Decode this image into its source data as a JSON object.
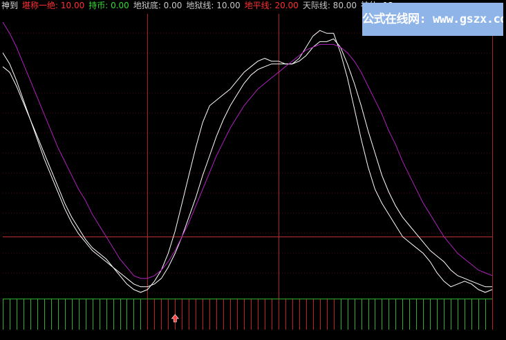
{
  "header": [
    {
      "label": "神到",
      "color": "#dcdcdc"
    },
    {
      "label": "堪称一绝: 10.00",
      "color": "#ff3030"
    },
    {
      "label": "持币: 0.00",
      "color": "#33dd33"
    },
    {
      "label": "地狱底: 0.00",
      "color": "#c8c8c8"
    },
    {
      "label": "地狱线: 10.00",
      "color": "#c8c8c8"
    },
    {
      "label": "地平线: 20.00",
      "color": "#ff3030"
    },
    {
      "label": "天际线: 80.00",
      "color": "#c8c8c8"
    },
    {
      "label": "神仙: 13",
      "color": "#ffffff"
    }
  ],
  "watermark": "公式在线网: www.gszx.com.cn",
  "colors": {
    "background": "#000000",
    "grid": "#5a1010",
    "vline": "#b02020",
    "hline": "#c03030",
    "fast_line": "#ffffff",
    "slow_line": "#b020c0",
    "hold_bar": "#2fb02f",
    "buy_bar": "#c02020",
    "buy_arrow": "#ff4040"
  },
  "chart_data": {
    "type": "line",
    "n": 72,
    "ylim": [
      0,
      100
    ],
    "reference_lines": {
      "地狱底": 0,
      "地狱线": 10,
      "地平线": 20,
      "天际线": 80
    },
    "vertical_markers_at_index": [
      21,
      40,
      71
    ],
    "series": [
      {
        "name": "fast",
        "values": [
          86,
          82,
          76,
          69,
          62,
          56,
          50,
          44,
          38,
          32,
          27,
          23,
          19,
          16,
          14,
          12,
          9,
          6,
          3,
          1,
          0,
          1,
          4,
          8,
          14,
          22,
          32,
          42,
          52,
          61,
          67,
          69,
          71,
          73,
          76,
          79,
          81,
          83,
          84,
          83,
          83,
          82,
          82,
          84,
          88,
          92,
          94,
          93,
          93,
          86,
          77,
          66,
          55,
          45,
          37,
          32,
          28,
          24,
          20,
          18,
          16,
          14,
          11,
          7,
          4,
          2,
          3,
          4,
          3,
          1,
          0,
          1
        ]
      },
      {
        "name": "mid",
        "values": [
          81,
          79,
          74,
          68,
          62,
          55,
          48,
          42,
          36,
          30,
          25,
          21,
          18,
          15,
          13,
          11,
          9,
          7,
          5,
          3,
          2,
          2,
          3,
          5,
          9,
          14,
          20,
          27,
          34,
          42,
          49,
          56,
          62,
          67,
          71,
          75,
          78,
          80,
          81,
          82,
          82,
          82,
          82,
          83,
          85,
          88,
          90,
          90,
          91,
          88,
          82,
          75,
          67,
          58,
          50,
          42,
          36,
          31,
          27,
          24,
          21,
          18,
          15,
          13,
          11,
          8,
          6,
          5,
          4,
          3,
          2,
          2
        ]
      },
      {
        "name": "slow",
        "values": [
          97,
          93,
          88,
          82,
          76,
          70,
          64,
          58,
          52,
          47,
          42,
          37,
          33,
          28,
          24,
          20,
          16,
          12,
          9,
          6,
          5,
          5,
          6,
          8,
          11,
          15,
          20,
          25,
          31,
          37,
          43,
          49,
          54,
          59,
          63,
          67,
          70,
          73,
          75,
          77,
          79,
          81,
          83,
          85,
          87,
          88,
          89,
          89,
          89,
          88,
          86,
          83,
          79,
          74,
          69,
          64,
          58,
          53,
          47,
          42,
          37,
          32,
          28,
          24,
          20,
          17,
          14,
          12,
          10,
          8,
          7,
          6
        ]
      }
    ],
    "signal": {
      "type": "bar",
      "states": [
        "hold",
        "hold",
        "hold",
        "hold",
        "hold",
        "hold",
        "hold",
        "hold",
        "hold",
        "hold",
        "hold",
        "hold",
        "hold",
        "hold",
        "hold",
        "hold",
        "hold",
        "hold",
        "hold",
        "hold",
        "hold",
        "buy",
        "buy",
        "buy",
        "buy",
        "buy",
        "buy",
        "buy",
        "buy",
        "buy",
        "buy",
        "buy",
        "buy",
        "buy",
        "buy",
        "buy",
        "buy",
        "buy",
        "buy",
        "buy",
        "buy",
        "buy",
        "buy",
        "buy",
        "buy",
        "buy",
        "buy",
        "buy",
        "buy",
        "hold",
        "hold",
        "hold",
        "hold",
        "hold",
        "hold",
        "hold",
        "hold",
        "hold",
        "hold",
        "hold",
        "hold",
        "hold",
        "hold",
        "hold",
        "hold",
        "hold",
        "hold",
        "hold",
        "hold",
        "hold",
        "hold",
        "buy"
      ],
      "buy_arrow_index": 25
    }
  }
}
